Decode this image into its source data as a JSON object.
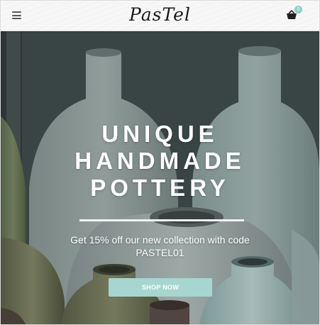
{
  "header": {
    "logo_text": "PasTel",
    "menu_icon": "hamburger-menu-icon",
    "cart_icon": "shopping-basket-icon",
    "cart_count": "0"
  },
  "hero": {
    "title_lines": [
      "UNIQUE",
      "HANDMADE",
      "POTTERY"
    ],
    "promo_line1": "Get 15% off our new collection with code",
    "promo_line2": "PASTEL01",
    "cta_label": "SHOP NOW"
  },
  "colors": {
    "accent": "#a6d6cf",
    "badge": "#8fcfc7",
    "header_bg": "#f5f5f5"
  }
}
